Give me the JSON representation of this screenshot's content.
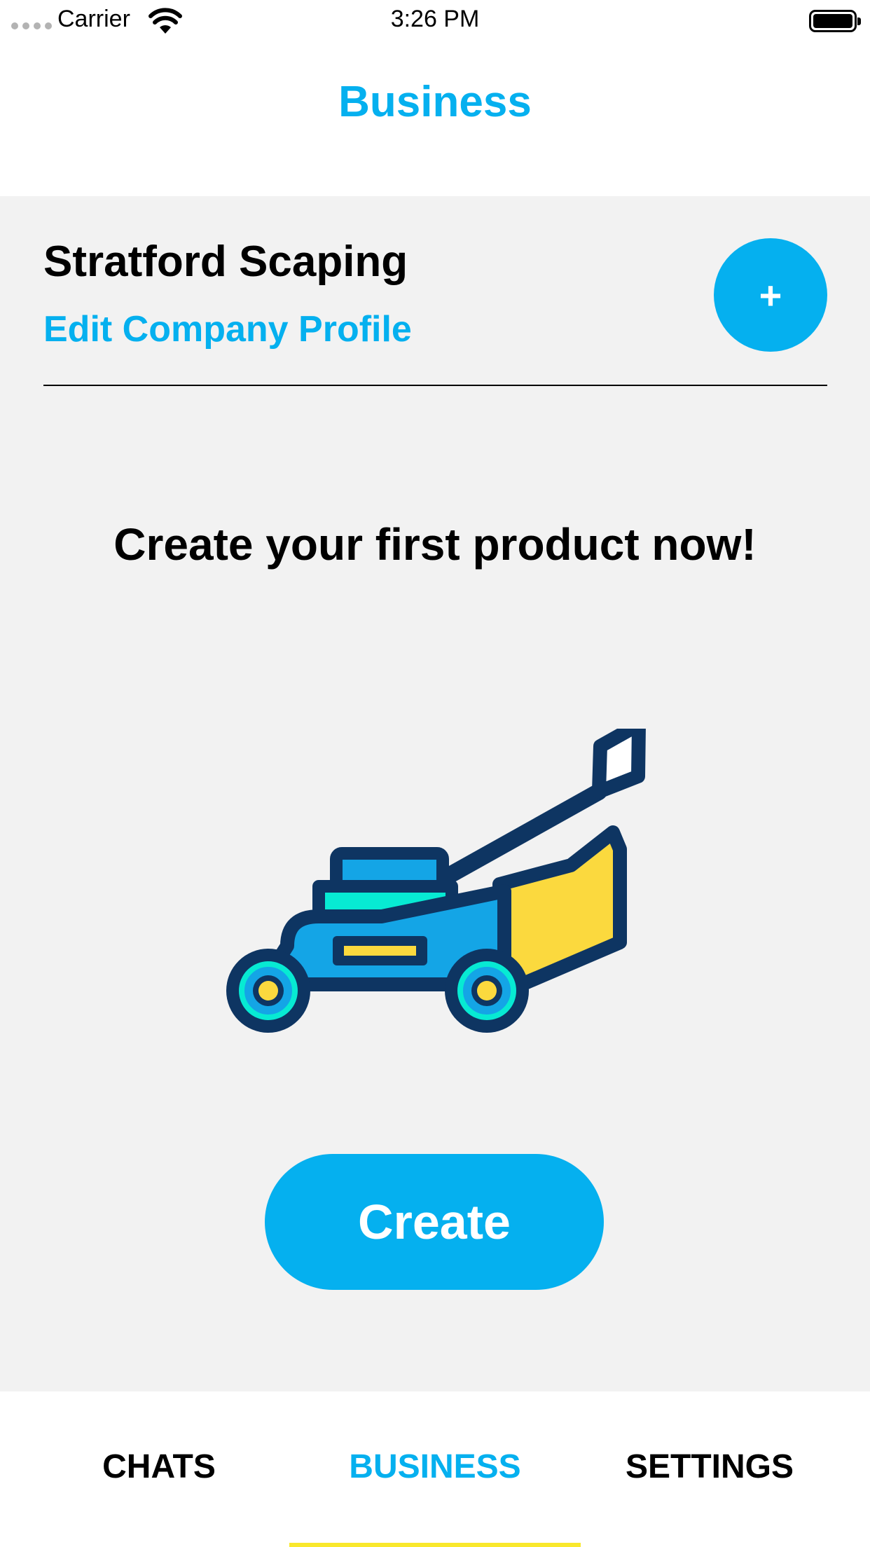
{
  "status_bar": {
    "carrier": "Carrier",
    "time": "3:26 PM"
  },
  "nav": {
    "title": "Business"
  },
  "company": {
    "name": "Stratford Scaping",
    "edit_label": "Edit Company Profile",
    "add_label": "+"
  },
  "empty_state": {
    "heading": "Create your first product now!",
    "illustration_icon": "lawn-mower-icon",
    "create_label": "Create"
  },
  "tabs": [
    {
      "label": "CHATS",
      "active": false
    },
    {
      "label": "BUSINESS",
      "active": true
    },
    {
      "label": "SETTINGS",
      "active": false
    }
  ],
  "colors": {
    "accent": "#05b0ef",
    "tab_indicator": "#f9e82c",
    "background": "#f2f2f2",
    "mower_dark": "#0e3562",
    "mower_blue": "#14a5e6",
    "mower_teal": "#07ead3",
    "mower_yellow": "#fbd93e"
  }
}
